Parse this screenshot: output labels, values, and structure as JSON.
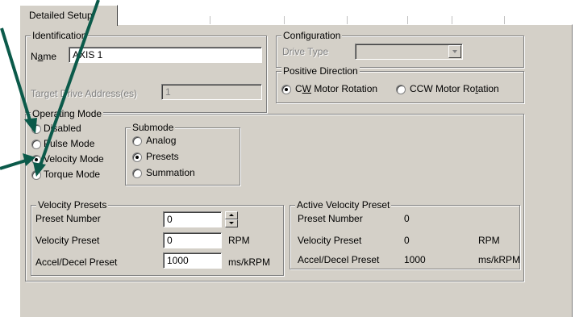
{
  "tab": {
    "label": "Detailed Setup"
  },
  "identification": {
    "legend": "Identification",
    "name_label_pre": "N",
    "name_label_ul": "a",
    "name_label_post": "me",
    "name_value": "AXIS 1",
    "target_label": "Target Drive Address(es)",
    "target_value": "1"
  },
  "configuration": {
    "legend": "Configuration",
    "drive_type_label": "Drive Type",
    "drive_type_value": ""
  },
  "positive_direction": {
    "legend": "Positive Direction",
    "cw_pre": "C",
    "cw_ul": "W",
    "cw_post": " Motor Rotation",
    "ccw_pre": "CCW Motor Ro",
    "ccw_ul": "t",
    "ccw_post": "ation",
    "selected": "cw"
  },
  "operating_mode": {
    "legend": "Operating Mode",
    "options": [
      "Disabled",
      "Pulse Mode",
      "Velocity Mode",
      "Torque Mode"
    ],
    "selected": "Velocity Mode"
  },
  "submode": {
    "legend": "Submode",
    "options": [
      "Analog",
      "Presets",
      "Summation"
    ],
    "selected": "Presets"
  },
  "velocity_presets": {
    "legend": "Velocity Presets",
    "preset_number_label": "Preset Number",
    "preset_number_value": "0",
    "velocity_label": "Velocity Preset",
    "velocity_value": "0",
    "velocity_unit": "RPM",
    "accel_label": "Accel/Decel Preset",
    "accel_value": "1000",
    "accel_unit": "ms/kRPM"
  },
  "active_velocity_preset": {
    "legend": "Active Velocity Preset",
    "preset_number_label": "Preset Number",
    "preset_number_value": "0",
    "velocity_label": "Velocity Preset",
    "velocity_value": "0",
    "velocity_unit": "RPM",
    "accel_label": "Accel/Decel Preset",
    "accel_value": "1000",
    "accel_unit": "ms/kRPM"
  },
  "colors": {
    "dialog_bg": "#d4d0c8",
    "arrow": "#0b5a4a"
  }
}
